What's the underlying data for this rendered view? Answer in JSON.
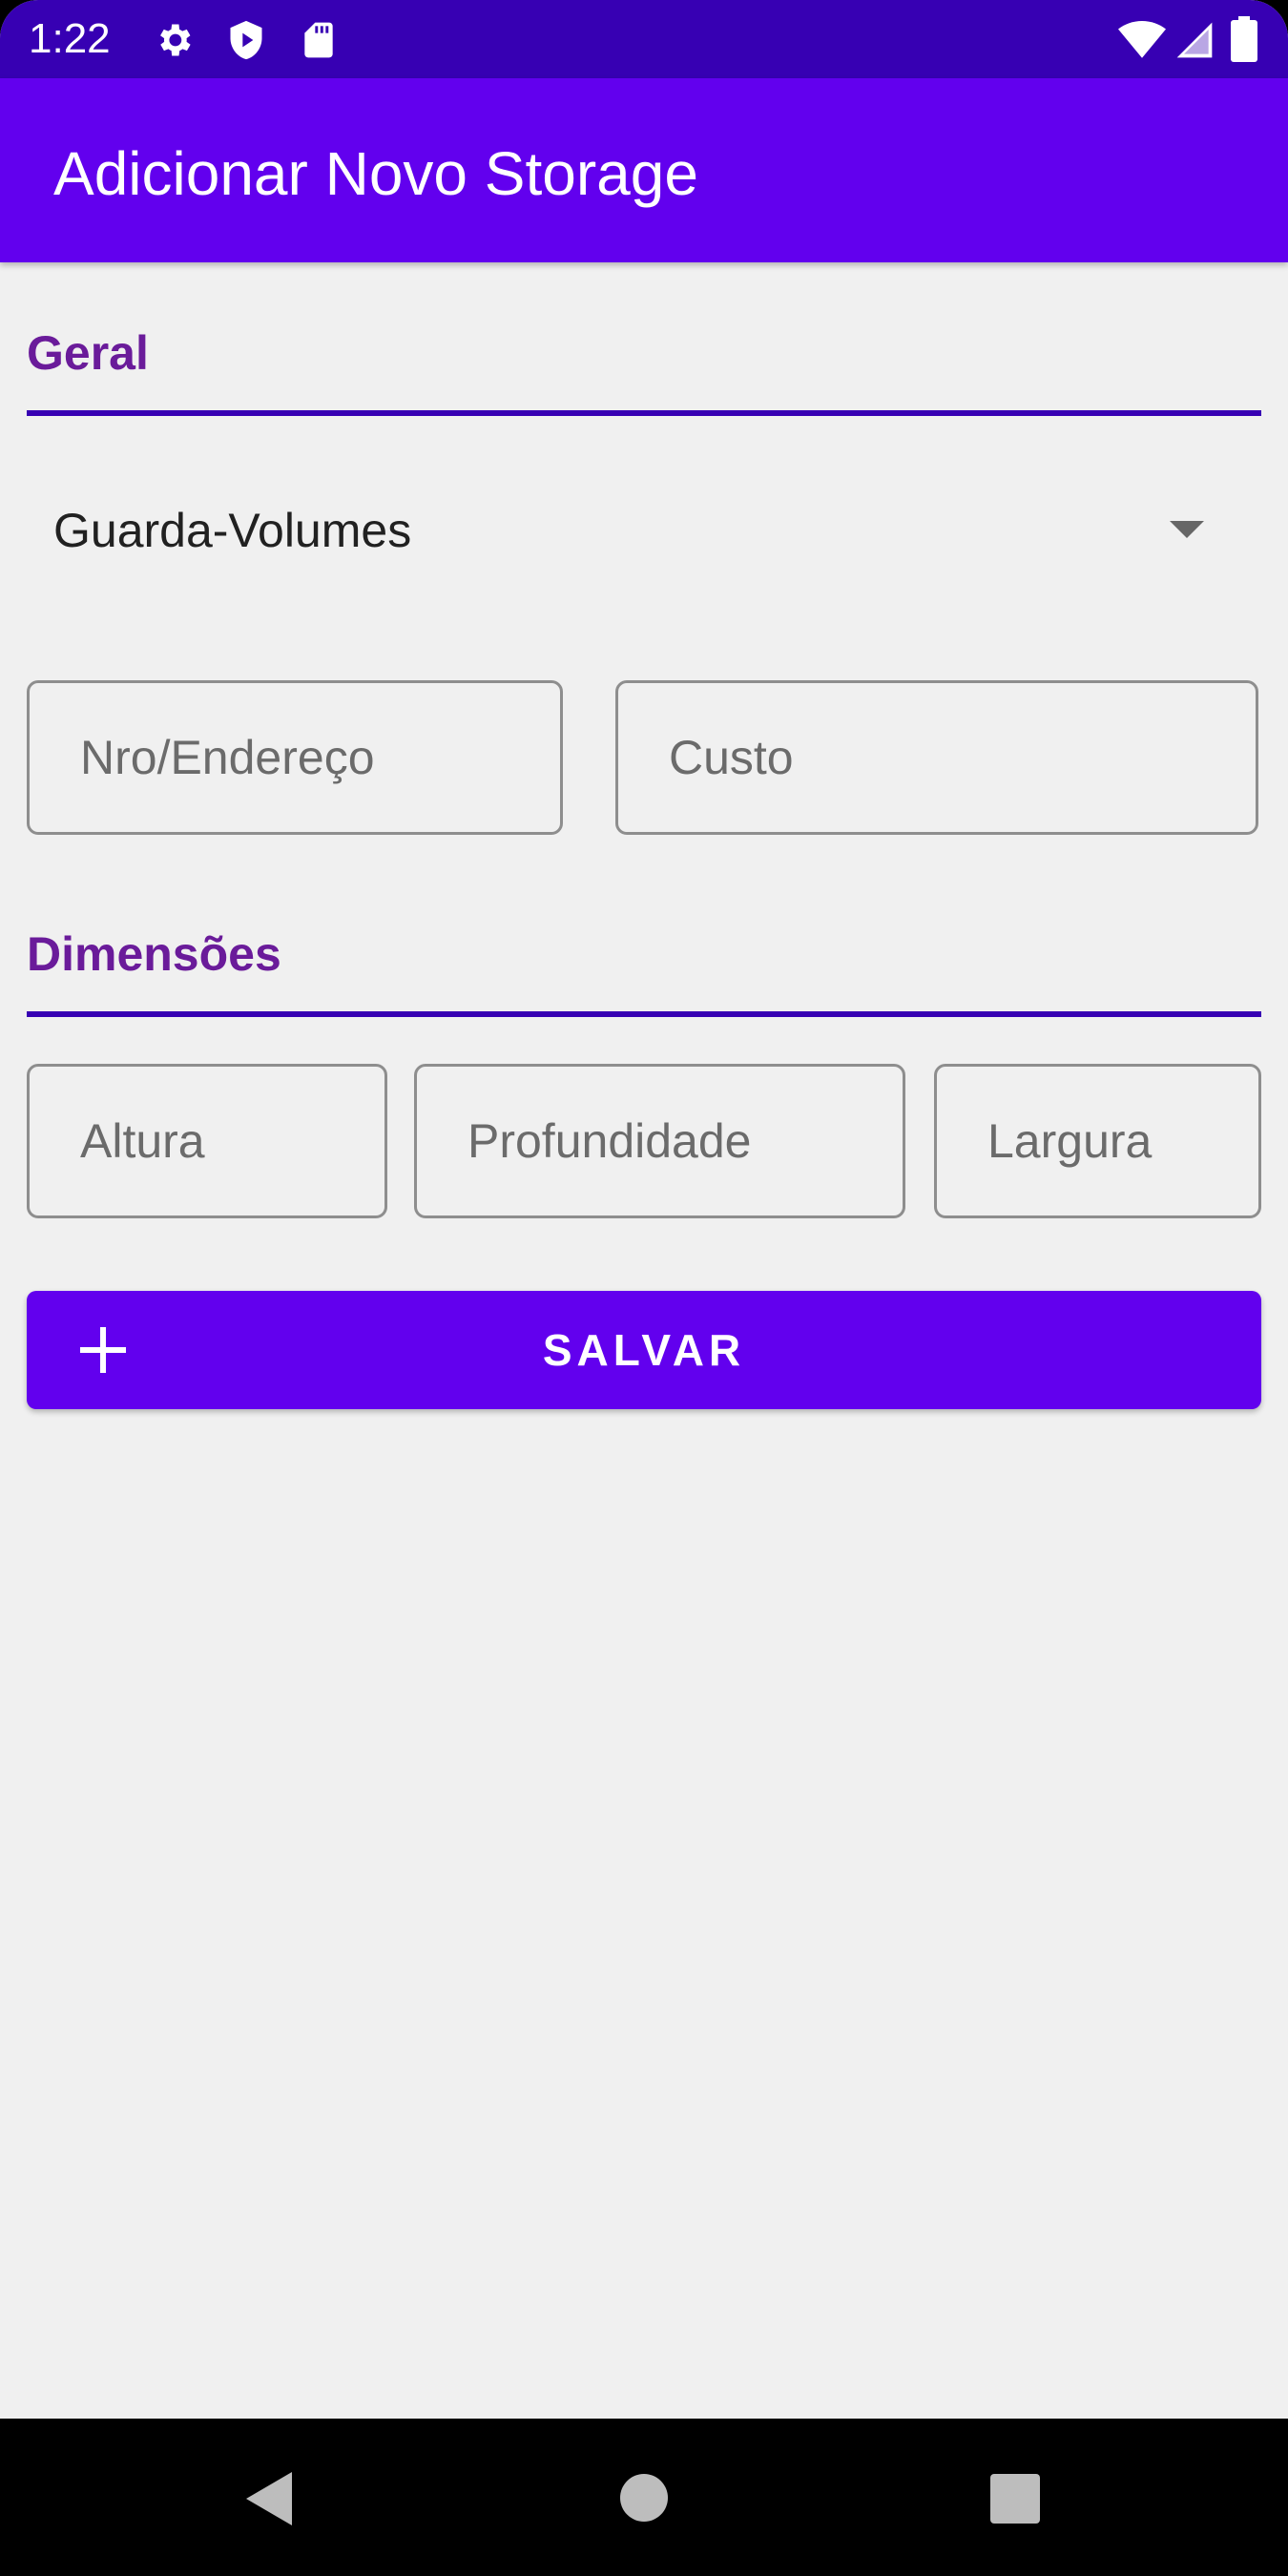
{
  "status_bar": {
    "time": "1:22",
    "icons": [
      "gear-icon",
      "shield-play-icon",
      "sd-card-icon",
      "wifi-icon",
      "signal-icon",
      "battery-icon"
    ]
  },
  "app_bar": {
    "title": "Adicionar Novo Storage"
  },
  "sections": {
    "general": {
      "title": "Geral"
    },
    "dimensions": {
      "title": "Dimensões"
    }
  },
  "form": {
    "type_spinner": {
      "selected": "Guarda-Volumes"
    },
    "number_field": {
      "value": "",
      "placeholder": "Nro/Endereço"
    },
    "cost_field": {
      "value": "",
      "placeholder": "Custo"
    },
    "height_field": {
      "value": "",
      "placeholder": "Altura"
    },
    "depth_field": {
      "value": "",
      "placeholder": "Profundidade"
    },
    "width_field": {
      "value": "",
      "placeholder": "Largura"
    }
  },
  "save_button": {
    "label": "SALVAR",
    "icon": "plus-icon"
  },
  "nav_bar": {
    "icons": [
      "back-icon",
      "home-icon",
      "recents-icon"
    ]
  },
  "colors": {
    "status_bar": "#3700b3",
    "app_bar": "#6200ee",
    "section_title": "#6a1b9a",
    "section_line": "#3700b3",
    "button": "#6200ee",
    "background": "#f0f0f0"
  }
}
